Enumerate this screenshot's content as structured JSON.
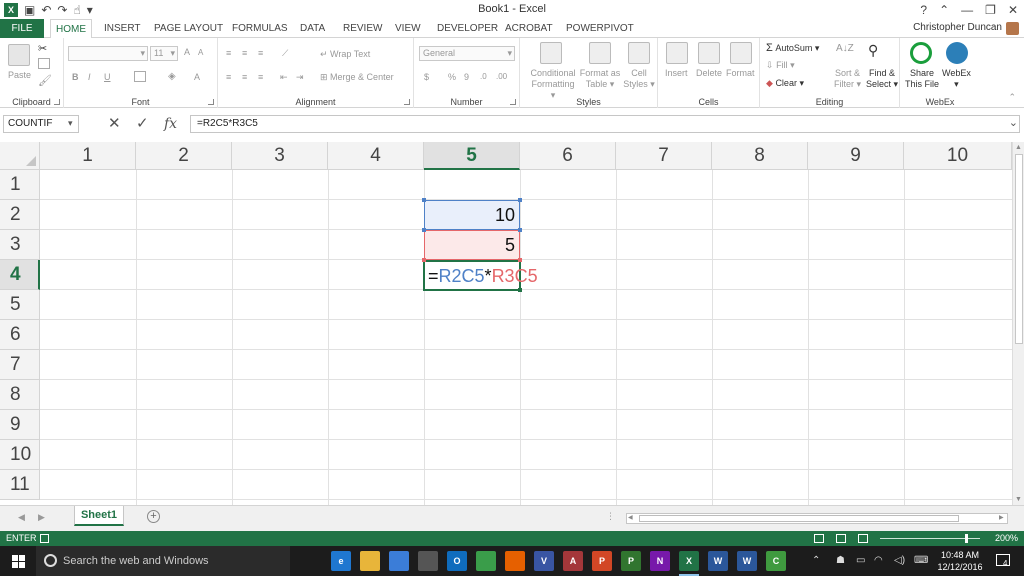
{
  "window": {
    "title": "Book1 - Excel",
    "help": "?",
    "min": "—",
    "restore": "❐",
    "close": "✕",
    "ribbon_toggle": "⌃"
  },
  "qat": {
    "save_icon": "save-icon",
    "undo": "↶",
    "redo": "↷",
    "touch": "☝",
    "customize": "▾"
  },
  "tabs": [
    "FILE",
    "HOME",
    "INSERT",
    "PAGE LAYOUT",
    "FORMULAS",
    "DATA",
    "REVIEW",
    "VIEW",
    "DEVELOPER",
    "ACROBAT",
    "POWERPIVOT"
  ],
  "user": {
    "name": "Christopher Duncan"
  },
  "ribbon": {
    "clipboard": {
      "label": "Clipboard",
      "paste": "Paste"
    },
    "font": {
      "label": "Font",
      "font_size": "11",
      "grow": "A",
      "shrink": "A",
      "bold": "B",
      "italic": "I",
      "underline": "U",
      "font_color": "A"
    },
    "alignment": {
      "label": "Alignment",
      "wrap": "Wrap Text",
      "merge": "Merge & Center"
    },
    "number": {
      "label": "Number",
      "format": "General",
      "currency": "$",
      "percent": "%",
      "comma": "9",
      "inc": ".0",
      "dec": ".00"
    },
    "styles": {
      "label": "Styles",
      "cond1": "Conditional",
      "cond2": "Formatting",
      "fmt1": "Format as",
      "fmt2": "Table",
      "cell1": "Cell",
      "cell2": "Styles"
    },
    "cells": {
      "label": "Cells",
      "insert": "Insert",
      "delete": "Delete",
      "format": "Format"
    },
    "editing": {
      "label": "Editing",
      "autosum": "AutoSum",
      "fill": "Fill",
      "clear": "Clear",
      "sort1": "Sort &",
      "sort2": "Filter",
      "find1": "Find &",
      "find2": "Select"
    },
    "webex": {
      "label": "WebEx",
      "share1": "Share",
      "share2": "This File",
      "webex": "WebEx"
    }
  },
  "formula_bar": {
    "name_box": "COUNTIF",
    "cancel": "✕",
    "enter": "✓",
    "fx": "fx",
    "formula": "=R2C5*R3C5"
  },
  "columns": [
    "1",
    "2",
    "3",
    "4",
    "5",
    "6",
    "7",
    "8",
    "9",
    "10"
  ],
  "rows": [
    "1",
    "2",
    "3",
    "4",
    "5",
    "6",
    "7",
    "8",
    "9",
    "10",
    "11"
  ],
  "cells": {
    "r2c5": "10",
    "r3c5": "5",
    "r4c5": {
      "eq": "=",
      "ref1": "R2C5",
      "op": "*",
      "ref2": "R3C5"
    }
  },
  "sheets": {
    "active": "Sheet1",
    "add": "+",
    "prev": "◀",
    "next": "▶"
  },
  "status": {
    "mode": "ENTER",
    "zoom": "200%"
  },
  "taskbar": {
    "search_placeholder": "Search the web and Windows",
    "apps": [
      {
        "name": "task-view",
        "label": "",
        "color": "#1c1c1c"
      },
      {
        "name": "edge",
        "label": "e",
        "color": "#1f77d0"
      },
      {
        "name": "file-explorer",
        "label": "",
        "color": "#e8b53a"
      },
      {
        "name": "store",
        "label": "",
        "color": "#3b7dd8"
      },
      {
        "name": "calculator",
        "label": "",
        "color": "#555555"
      },
      {
        "name": "outlook",
        "label": "O",
        "color": "#0f6cbd"
      },
      {
        "name": "chrome",
        "label": "",
        "color": "#3a9d4a"
      },
      {
        "name": "firefox",
        "label": "",
        "color": "#e66000"
      },
      {
        "name": "visio",
        "label": "V",
        "color": "#3955a3"
      },
      {
        "name": "access",
        "label": "A",
        "color": "#a4373a"
      },
      {
        "name": "powerpoint",
        "label": "P",
        "color": "#d24726"
      },
      {
        "name": "project",
        "label": "P",
        "color": "#31752f"
      },
      {
        "name": "onenote",
        "label": "N",
        "color": "#7719aa"
      },
      {
        "name": "excel",
        "label": "X",
        "color": "#217346"
      },
      {
        "name": "word",
        "label": "W",
        "color": "#2b579a"
      },
      {
        "name": "word-2",
        "label": "W",
        "color": "#2b579a"
      },
      {
        "name": "camtasia",
        "label": "C",
        "color": "#3f9a3f"
      }
    ],
    "time": "10:48 AM",
    "date": "12/12/2016",
    "notifications": "4"
  },
  "colors": {
    "excel_green": "#217346",
    "ref_blue": "#4f81c7",
    "ref_red": "#e5676a"
  }
}
